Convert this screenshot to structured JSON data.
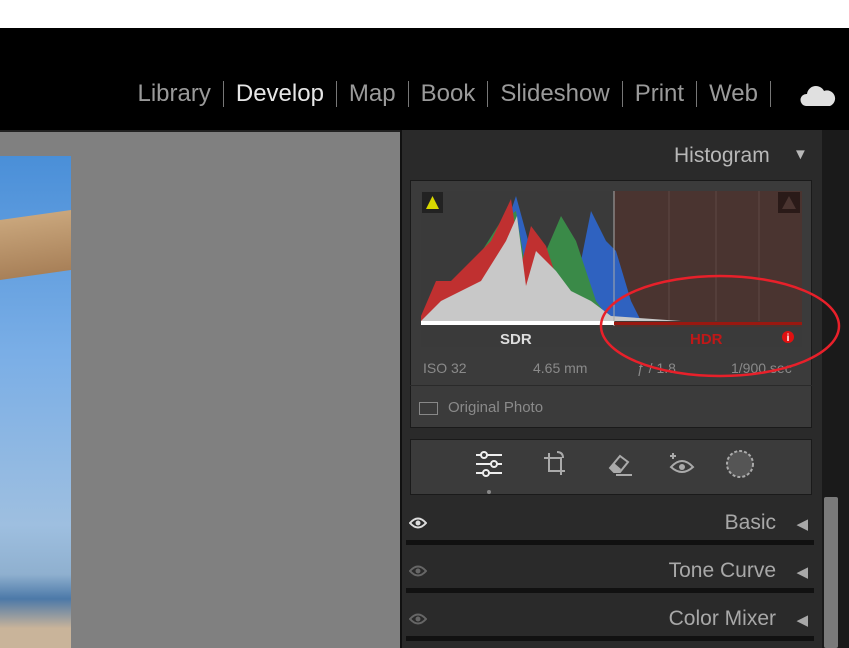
{
  "nav": {
    "items": [
      {
        "label": "Library",
        "active": false
      },
      {
        "label": "Develop",
        "active": true
      },
      {
        "label": "Map",
        "active": false
      },
      {
        "label": "Book",
        "active": false
      },
      {
        "label": "Slideshow",
        "active": false
      },
      {
        "label": "Print",
        "active": false
      },
      {
        "label": "Web",
        "active": false
      }
    ],
    "cloud_icon": "cloud-icon"
  },
  "histogram": {
    "title": "Histogram",
    "sdr_label": "SDR",
    "hdr_label": "HDR",
    "iso": "ISO 32",
    "focal": "4.65 mm",
    "aperture": "ƒ / 1.8",
    "shutter": "1/900 sec",
    "original_photo": "Original Photo",
    "colors": {
      "hdr": "#c01818",
      "annotation": "#e8202a"
    }
  },
  "tools": [
    "edit-sliders-icon",
    "crop-icon",
    "healing-eraser-icon",
    "red-eye-icon",
    "masking-icon"
  ],
  "sections": [
    {
      "label": "Basic"
    },
    {
      "label": "Tone Curve"
    },
    {
      "label": "Color Mixer"
    }
  ]
}
